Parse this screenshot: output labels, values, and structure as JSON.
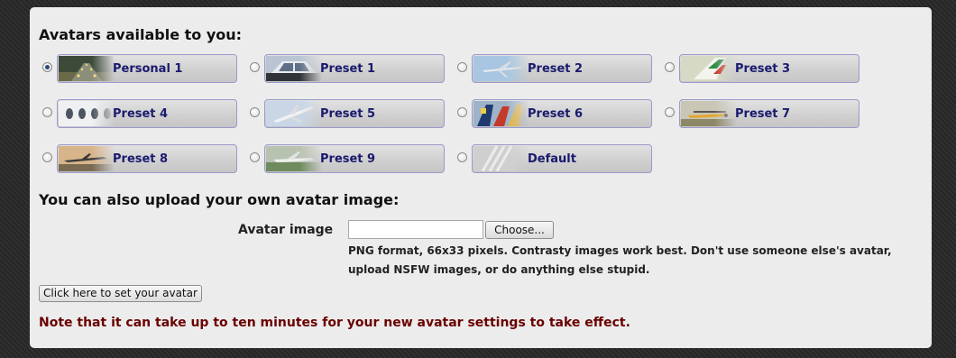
{
  "heading_avatars": "Avatars available to you:",
  "avatars": [
    {
      "label": "Personal 1",
      "selected": true,
      "thumb": "runway-lights"
    },
    {
      "label": "Preset 1",
      "selected": false,
      "thumb": "cockpit"
    },
    {
      "label": "Preset 2",
      "selected": false,
      "thumb": "plane-sky"
    },
    {
      "label": "Preset 3",
      "selected": false,
      "thumb": "tail-fin"
    },
    {
      "label": "Preset 4",
      "selected": false,
      "thumb": "windows"
    },
    {
      "label": "Preset 5",
      "selected": false,
      "thumb": "plane-climb"
    },
    {
      "label": "Preset 6",
      "selected": false,
      "thumb": "tails"
    },
    {
      "label": "Preset 7",
      "selected": false,
      "thumb": "small-plane"
    },
    {
      "label": "Preset 8",
      "selected": false,
      "thumb": "jet-sunset"
    },
    {
      "label": "Preset 9",
      "selected": false,
      "thumb": "plane-ground"
    },
    {
      "label": "Default",
      "selected": false,
      "thumb": "stripes"
    }
  ],
  "heading_upload": "You can also upload your own avatar image:",
  "upload": {
    "label": "Avatar image",
    "file_value": "",
    "choose_label": "Choose...",
    "help_line1": "PNG format, 66x33 pixels. Contrasty images work best. Don't use someone else's avatar,",
    "help_line2": "upload NSFW images, or do anything else stupid."
  },
  "submit_label": "Click here to set your avatar",
  "note": "Note that it can take up to ten minutes for your new avatar settings to take effect."
}
